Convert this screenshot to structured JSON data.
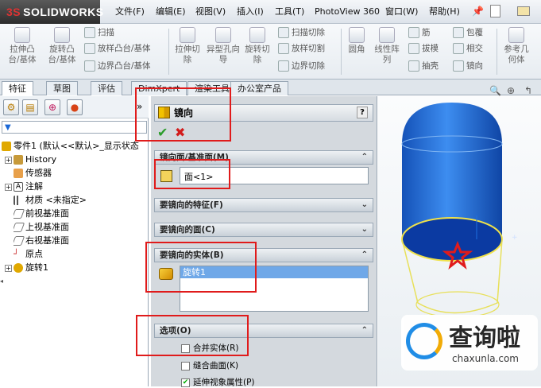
{
  "app": {
    "logo_text": "SOLIDWORKS",
    "logo_mark": "3S"
  },
  "menu": [
    "文件(F)",
    "编辑(E)",
    "视图(V)",
    "插入(I)",
    "工具(T)",
    "PhotoView 360",
    "窗口(W)",
    "帮助(H)"
  ],
  "ribbon": {
    "big": [
      "拉伸凸台/基体",
      "旋转凸台/基体",
      "拉伸切除",
      "异型孔向导",
      "旋转切除",
      "圆角",
      "线性阵列",
      "参考几何体"
    ],
    "small": [
      "扫描",
      "放样凸台/基体",
      "边界凸台/基体",
      "扫描切除",
      "放样切割",
      "边界切除",
      "筋",
      "拔模",
      "抽壳",
      "包覆",
      "相交",
      "镜向"
    ]
  },
  "tabs": [
    "特征",
    "草图",
    "评估",
    "DimXpert",
    "渲染工具",
    "办公室产品"
  ],
  "tree": {
    "root": "零件1 (默认<<默认>_显示状态",
    "items": [
      "History",
      "传感器",
      "注解",
      "材质 <未指定>",
      "前视基准面",
      "上视基准面",
      "右视基准面",
      "原点",
      "旋转1"
    ]
  },
  "pm": {
    "title": "镜向",
    "help": "?",
    "sections": {
      "mirror_face": "镜向面/基准面(M)",
      "features": "要镜向的特征(F)",
      "faces": "要镜向的面(C)",
      "bodies": "要镜向的实体(B)",
      "options": "选项(O)"
    },
    "mirror_face_value": "面<1>",
    "body_value": "旋转1",
    "options": [
      "合并实体(R)",
      "缝合曲面(K)",
      "延伸视象属性(P)"
    ]
  },
  "watermark": {
    "title": "查询啦",
    "url": "chaxunla.com"
  },
  "colors": {
    "red_box": "#e01b1b",
    "body_blue": "#1e6fe0",
    "accent": "#1a67d6"
  }
}
